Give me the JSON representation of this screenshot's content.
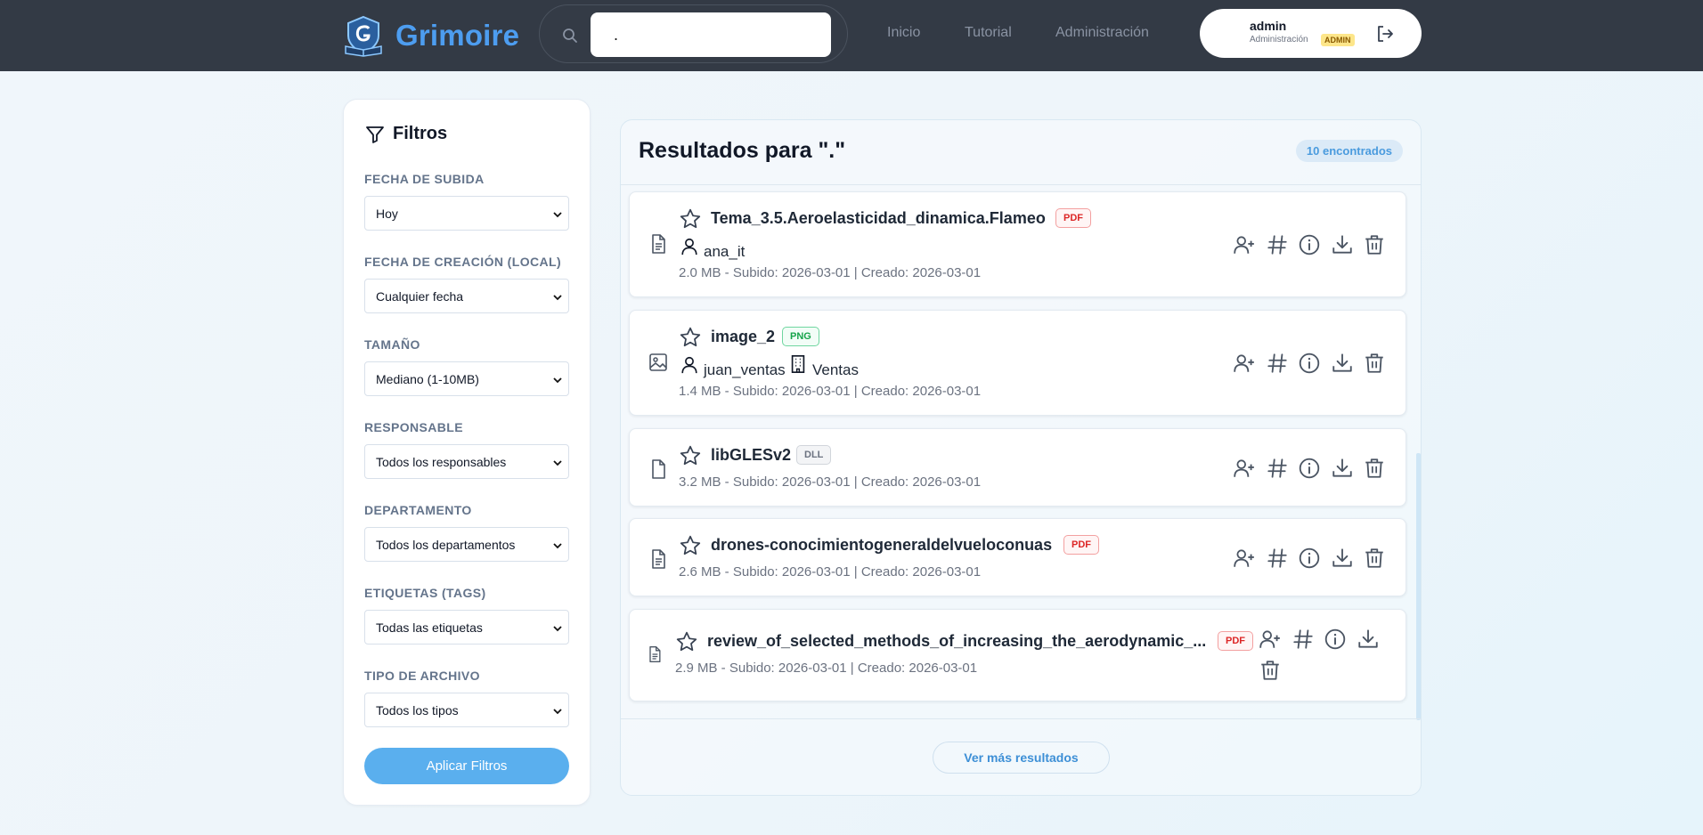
{
  "app": {
    "name": "Grimoire"
  },
  "search": {
    "value": "."
  },
  "nav": {
    "inicio": "Inicio",
    "tutorial": "Tutorial",
    "administracion": "Administración"
  },
  "user": {
    "name": "admin",
    "role": "Administración",
    "badge": "ADMIN"
  },
  "filters": {
    "title": "Filtros",
    "fecha_subida": {
      "label": "FECHA DE SUBIDA",
      "value": "Hoy"
    },
    "fecha_creacion": {
      "label": "FECHA DE CREACIÓN (LOCAL)",
      "value": "Cualquier fecha"
    },
    "tamano": {
      "label": "TAMAÑO",
      "value": "Mediano (1-10MB)"
    },
    "responsable": {
      "label": "RESPONSABLE",
      "value": "Todos los responsables"
    },
    "departamento": {
      "label": "DEPARTAMENTO",
      "value": "Todos los departamentos"
    },
    "etiquetas": {
      "label": "ETIQUETAS (TAGS)",
      "value": "Todas las etiquetas"
    },
    "tipo": {
      "label": "TIPO DE ARCHIVO",
      "value": "Todos los tipos"
    },
    "apply_label": "Aplicar Filtros"
  },
  "results": {
    "title": "Resultados para \".\"",
    "count": "10 encontrados",
    "more_label": "Ver más resultados",
    "items": [
      {
        "name": "Tema_3.5.Aeroelasticidad_dinamica.Flameo",
        "type": "PDF",
        "icon": "document-icon",
        "owner": "ana_it",
        "meta": "2.0 MB - Subido: 2026-03-01 | Creado: 2026-03-01"
      },
      {
        "name": "image_2",
        "type": "PNG",
        "icon": "image-icon",
        "owner": "juan_ventas",
        "department": "Ventas",
        "meta": "1.4 MB - Subido: 2026-03-01 | Creado: 2026-03-01"
      },
      {
        "name": "libGLESv2",
        "type": "DLL",
        "icon": "file-icon",
        "meta": "3.2 MB - Subido: 2026-03-01 | Creado: 2026-03-01"
      },
      {
        "name": "drones-conocimientogeneraldelvueloconuas",
        "type": "PDF",
        "icon": "document-icon",
        "meta": "2.6 MB - Subido: 2026-03-01 | Creado: 2026-03-01"
      },
      {
        "name": "review_of_selected_methods_of_increasing_the_aerodynamic_...",
        "type": "PDF",
        "icon": "document-icon",
        "meta": "2.9 MB - Subido: 2026-03-01 | Creado: 2026-03-01"
      }
    ]
  },
  "colors": {
    "header_bg": "#333a45",
    "brand": "#4d9df0",
    "accent": "#5aafee",
    "pdf": "#dc2626",
    "png": "#16a34a"
  }
}
